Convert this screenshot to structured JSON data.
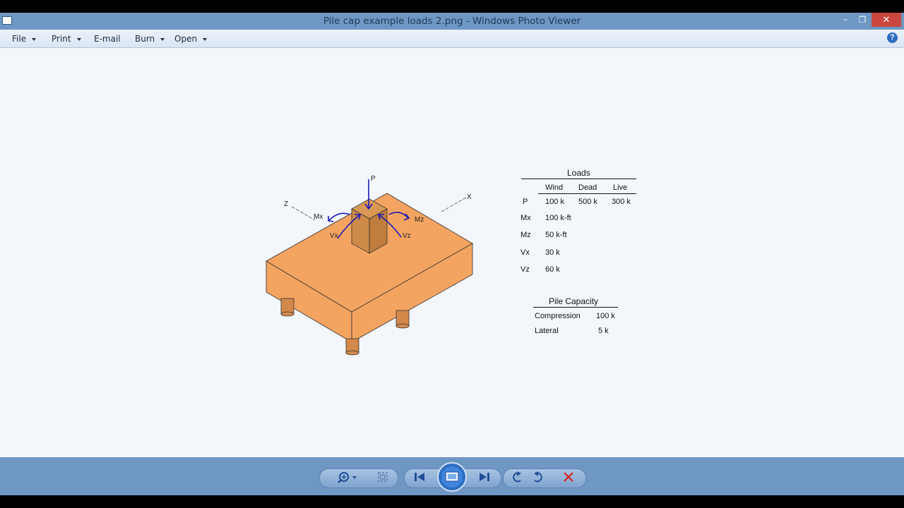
{
  "window": {
    "title": "Pile cap example loads 2.png - Windows Photo Viewer",
    "minimize_glyph": "−",
    "maximize_glyph": "❐",
    "close_glyph": "✕"
  },
  "menu": {
    "items": [
      {
        "label": "File",
        "has_dropdown": true
      },
      {
        "label": "Print",
        "has_dropdown": true
      },
      {
        "label": "E-mail",
        "has_dropdown": false
      },
      {
        "label": "Burn",
        "has_dropdown": true
      },
      {
        "label": "Open",
        "has_dropdown": true
      }
    ],
    "help_glyph": "?"
  },
  "figure": {
    "axes": {
      "z": "Z",
      "x": "X"
    },
    "load_labels": {
      "p": "P",
      "mx": "Mx",
      "mz": "Mz",
      "vx": "Vx",
      "vz": "Vz"
    },
    "colors": {
      "cap": "#f4a461",
      "column": "#cd8a48",
      "pile": "#d4894a",
      "arrows": "#1a1ab8"
    }
  },
  "loads_table": {
    "title": "Loads",
    "columns": [
      "Wind",
      "Dead",
      "Live"
    ],
    "rows": [
      {
        "label": "P",
        "values": [
          "100 k",
          "500 k",
          "300 k"
        ]
      },
      {
        "label": "Mx",
        "values": [
          "100 k-ft"
        ]
      },
      {
        "label": "Mz",
        "values": [
          "50 k-ft"
        ]
      },
      {
        "label": "Vx",
        "values": [
          "30 k"
        ]
      },
      {
        "label": "Vz",
        "values": [
          "60 k"
        ]
      }
    ]
  },
  "pile_capacity": {
    "title": "Pile Capacity",
    "rows": [
      {
        "label": "Compression",
        "value": "100 k"
      },
      {
        "label": "Lateral",
        "value": "5 k"
      }
    ]
  },
  "toolbar": {
    "zoom_icon": "magnifier-zoom",
    "actual_size_icon": "fit-window",
    "previous_icon": "previous",
    "slideshow_icon": "slideshow",
    "next_icon": "next",
    "rotate_ccw_icon": "rotate-counterclockwise",
    "rotate_cw_icon": "rotate-clockwise",
    "delete_icon": "delete"
  }
}
